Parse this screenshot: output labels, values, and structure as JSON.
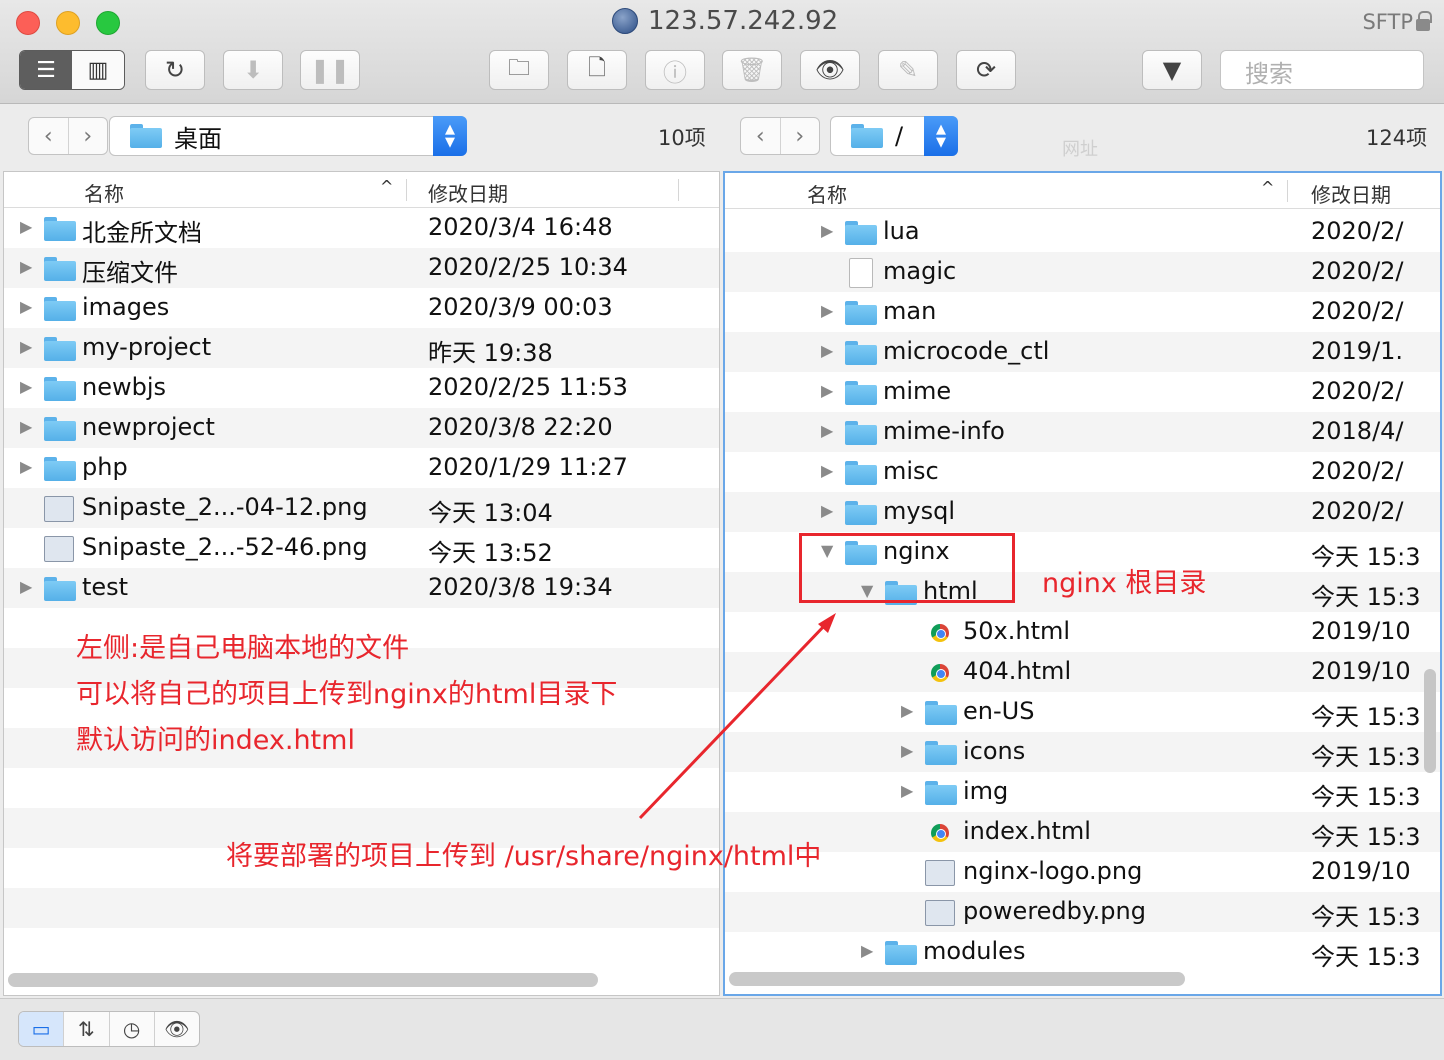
{
  "window": {
    "title": "123.57.242.92",
    "protocol": "SFTP"
  },
  "toolbar": {
    "view_list_icon": "list-view-icon",
    "view_columns_icon": "column-view-icon",
    "search_placeholder": "搜索"
  },
  "left_pane": {
    "path": "桌面",
    "count": "10项",
    "col_name": "名称",
    "col_date": "修改日期",
    "rows": [
      {
        "name": "北金所文档",
        "date": "2020/3/4 16:48",
        "kind": "folder"
      },
      {
        "name": "压缩文件",
        "date": "2020/2/25 10:34",
        "kind": "folder"
      },
      {
        "name": "images",
        "date": "2020/3/9 00:03",
        "kind": "folder"
      },
      {
        "name": "my-project",
        "date": "昨天 19:38",
        "kind": "folder"
      },
      {
        "name": "newbjs",
        "date": "2020/2/25 11:53",
        "kind": "folder"
      },
      {
        "name": "newproject",
        "date": "2020/3/8 22:20",
        "kind": "folder"
      },
      {
        "name": "php",
        "date": "2020/1/29 11:27",
        "kind": "folder"
      },
      {
        "name": "Snipaste_2...-04-12.png",
        "date": "今天 13:04",
        "kind": "image"
      },
      {
        "name": "Snipaste_2...-52-46.png",
        "date": "今天 13:52",
        "kind": "image"
      },
      {
        "name": "test",
        "date": "2020/3/8 19:34",
        "kind": "folder"
      }
    ]
  },
  "right_pane": {
    "path": "/",
    "count": "124项",
    "ghost_label": "网址",
    "col_name": "名称",
    "col_date": "修改日期",
    "rows": [
      {
        "name": "lua",
        "date": "2020/2/",
        "kind": "folder",
        "level": 0
      },
      {
        "name": "magic",
        "date": "2020/2/",
        "kind": "file",
        "level": 0
      },
      {
        "name": "man",
        "date": "2020/2/",
        "kind": "folder",
        "level": 0
      },
      {
        "name": "microcode_ctl",
        "date": "2019/1.",
        "kind": "folder",
        "level": 0
      },
      {
        "name": "mime",
        "date": "2020/2/",
        "kind": "folder",
        "level": 0
      },
      {
        "name": "mime-info",
        "date": "2018/4/",
        "kind": "folder",
        "level": 0
      },
      {
        "name": "misc",
        "date": "2020/2/",
        "kind": "folder",
        "level": 0
      },
      {
        "name": "mysql",
        "date": "2020/2/",
        "kind": "folder",
        "level": 0
      },
      {
        "name": "nginx",
        "date": "今天 15:3",
        "kind": "folder-open",
        "level": 0
      },
      {
        "name": "html",
        "date": "今天 15:3",
        "kind": "folder-open",
        "level": 1
      },
      {
        "name": "50x.html",
        "date": "2019/10",
        "kind": "html",
        "level": 2
      },
      {
        "name": "404.html",
        "date": "2019/10",
        "kind": "html",
        "level": 2
      },
      {
        "name": "en-US",
        "date": "今天 15:3",
        "kind": "folder",
        "level": 2
      },
      {
        "name": "icons",
        "date": "今天 15:3",
        "kind": "folder",
        "level": 2
      },
      {
        "name": "img",
        "date": "今天 15:3",
        "kind": "folder",
        "level": 2
      },
      {
        "name": "index.html",
        "date": "今天 15:3",
        "kind": "html",
        "level": 2
      },
      {
        "name": "nginx-logo.png",
        "date": "2019/10",
        "kind": "image",
        "level": 2
      },
      {
        "name": "poweredby.png",
        "date": "今天 15:3",
        "kind": "image",
        "level": 2
      },
      {
        "name": "modules",
        "date": "今天 15:3",
        "kind": "folder",
        "level": 1
      }
    ]
  },
  "annotations": {
    "nginx_root": "nginx 根目录",
    "left_line1": "左侧:是自己电脑本地的文件",
    "left_line2": "可以将自己的项目上传到nginx的html目录下",
    "left_line3": "默认访问的index.html",
    "upload_hint": "将要部署的项目上传到 /usr/share/nginx/html中"
  },
  "colors": {
    "annotation_red": "#e8262d",
    "accent_blue": "#1a6fe8",
    "folder_blue": "#55b0e8"
  }
}
